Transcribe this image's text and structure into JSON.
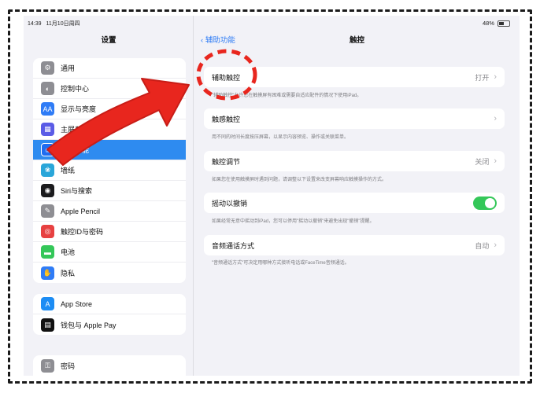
{
  "status": {
    "time": "14:39",
    "date": "11月10日周四",
    "battery": "48%"
  },
  "sidebar": {
    "title": "设置",
    "items": [
      {
        "label": "通用",
        "icon": "gear-icon"
      },
      {
        "label": "控制中心",
        "icon": "toggles-icon"
      },
      {
        "label": "显示与亮度",
        "icon": "aa-icon"
      },
      {
        "label": "主屏幕与程序坞",
        "icon": "grid-icon"
      },
      {
        "label": "辅助功能",
        "icon": "accessibility-icon"
      },
      {
        "label": "墙纸",
        "icon": "flower-icon"
      },
      {
        "label": "Siri与搜索",
        "icon": "siri-icon"
      },
      {
        "label": "Apple Pencil",
        "icon": "pencil-icon"
      },
      {
        "label": "触控ID与密码",
        "icon": "fingerprint-icon"
      },
      {
        "label": "电池",
        "icon": "battery-icon"
      },
      {
        "label": "隐私",
        "icon": "hand-icon"
      }
    ],
    "store_items": [
      {
        "label": "App Store",
        "icon": "appstore-icon"
      },
      {
        "label": "钱包与 Apple Pay",
        "icon": "wallet-icon"
      }
    ],
    "other_items": [
      {
        "label": "密码",
        "icon": "key-icon"
      }
    ]
  },
  "detail": {
    "back_label": "辅助功能",
    "title": "触控",
    "assistive_touch": {
      "label": "辅助触控",
      "value": "打开",
      "desc": "\"辅助触控\"允许您在触摸屏有困难或需要自适应配件的情况下使用iPad。"
    },
    "haptic_touch": {
      "label": "触感触控",
      "desc": "用不同的时间长度按压屏幕，以显示内容预览、操作或关联菜单。"
    },
    "touch_accommodations": {
      "label": "触控调节",
      "value": "关闭",
      "desc": "如果您在使用触摸屏时遇到问题，请调整以下设置来改变屏幕响应触摸操作的方式。"
    },
    "shake_to_undo": {
      "label": "摇动以撤销",
      "desc": "如果经常无意中摇动到iPad，您可以停用\"摇动以撤销\"来避免出现\"撤销\"提醒。"
    },
    "call_audio": {
      "label": "音频通话方式",
      "value": "自动",
      "desc": "\"音频通话方式\"可决定用哪种方式接听电话或FaceTime音频通话。"
    }
  },
  "colors": {
    "accent": "#2e8bf0",
    "annotation": "#e8261e",
    "toggle_on": "#34c759"
  }
}
